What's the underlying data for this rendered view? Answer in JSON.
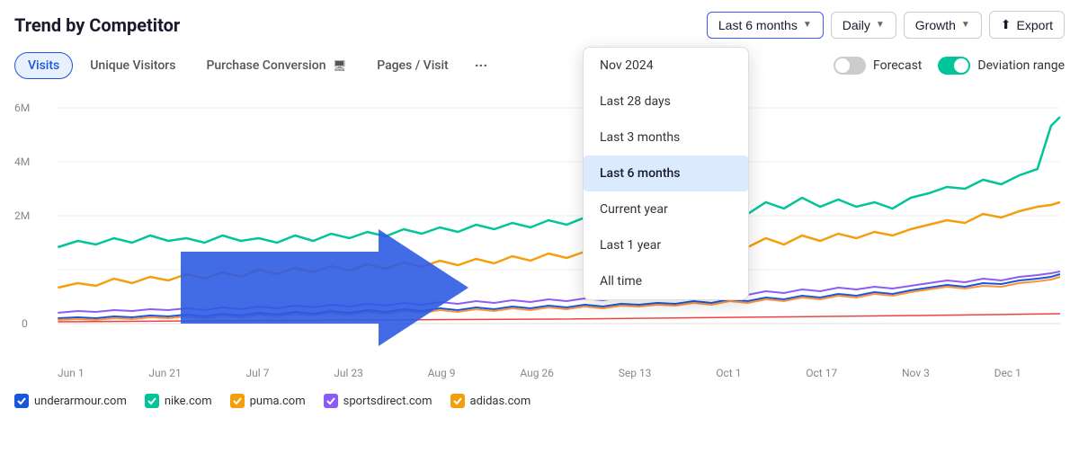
{
  "header": {
    "title": "Trend by Competitor",
    "controls": {
      "date_range_label": "Last 6 months",
      "frequency_label": "Daily",
      "metric_label": "Growth",
      "export_label": "Export"
    }
  },
  "tabs": [
    {
      "label": "Visits",
      "active": true
    },
    {
      "label": "Unique Visitors",
      "active": false
    },
    {
      "label": "Purchase Conversion",
      "active": false,
      "has_icon": true
    },
    {
      "label": "Pages / Visit",
      "active": false
    }
  ],
  "tab_more": "···",
  "toggles": {
    "forecast": {
      "label": "Forecast",
      "on": false
    },
    "deviation": {
      "label": "Deviation range",
      "on": true
    }
  },
  "dropdown": {
    "options": [
      {
        "label": "Nov 2024",
        "selected": false
      },
      {
        "label": "Last 28 days",
        "selected": false
      },
      {
        "label": "Last 3 months",
        "selected": false
      },
      {
        "label": "Last 6 months",
        "selected": true
      },
      {
        "label": "Current year",
        "selected": false
      },
      {
        "label": "Last 1 year",
        "selected": false
      },
      {
        "label": "All time",
        "selected": false
      }
    ]
  },
  "chart": {
    "y_labels": [
      "6M",
      "4M",
      "2M",
      "0"
    ],
    "x_labels": [
      "Jun 1",
      "Jun 21",
      "Jul 7",
      "Jul 23",
      "Aug 9",
      "Aug 26",
      "Sep 13",
      "Oct 1",
      "Oct 17",
      "Nov 3",
      "Dec 1"
    ]
  },
  "legend": [
    {
      "domain": "underarmour.com",
      "color": "#1a56db"
    },
    {
      "domain": "nike.com",
      "color": "#00c49a"
    },
    {
      "domain": "puma.com",
      "color": "#f59e0b"
    },
    {
      "domain": "sportsdirect.com",
      "color": "#8b5cf6"
    },
    {
      "domain": "adidas.com",
      "color": "#f59e0b"
    }
  ]
}
